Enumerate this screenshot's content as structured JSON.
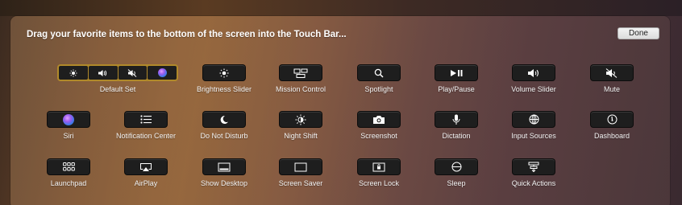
{
  "instruction": "Drag your favorite items to the bottom of the screen into the Touch Bar...",
  "done_label": "Done",
  "items": {
    "default_set": "Default Set",
    "brightness_slider": "Brightness Slider",
    "mission_control": "Mission Control",
    "spotlight": "Spotlight",
    "play_pause": "Play/Pause",
    "volume_slider": "Volume Slider",
    "mute": "Mute",
    "siri": "Siri",
    "notification_center": "Notification Center",
    "do_not_disturb": "Do Not Disturb",
    "night_shift": "Night Shift",
    "screenshot": "Screenshot",
    "dictation": "Dictation",
    "input_sources": "Input Sources",
    "dashboard": "Dashboard",
    "launchpad": "Launchpad",
    "airplay": "AirPlay",
    "show_desktop": "Show Desktop",
    "screen_saver": "Screen Saver",
    "screen_lock": "Screen Lock",
    "sleep": "Sleep",
    "quick_actions": "Quick Actions"
  },
  "icons": {
    "default_set": [
      "brightness-icon",
      "volume-icon",
      "mute-icon",
      "siri-icon"
    ],
    "brightness_slider": "brightness-icon",
    "mission_control": "mission-control-icon",
    "spotlight": "magnifier-icon",
    "play_pause": "play-pause-icon",
    "volume_slider": "volume-icon",
    "mute": "mute-icon",
    "siri": "siri-icon",
    "notification_center": "list-icon",
    "do_not_disturb": "moon-icon",
    "night_shift": "night-shift-icon",
    "screenshot": "camera-icon",
    "dictation": "microphone-icon",
    "input_sources": "globe-icon",
    "dashboard": "gauge-icon",
    "launchpad": "grid-icon",
    "airplay": "airplay-icon",
    "show_desktop": "desktop-icon",
    "screen_saver": "screen-icon",
    "screen_lock": "lock-screen-icon",
    "sleep": "sleep-icon",
    "quick_actions": "quick-actions-icon"
  },
  "colors": {
    "default_set_highlight": "#b0892a",
    "key_background": "#1e1e1e"
  }
}
